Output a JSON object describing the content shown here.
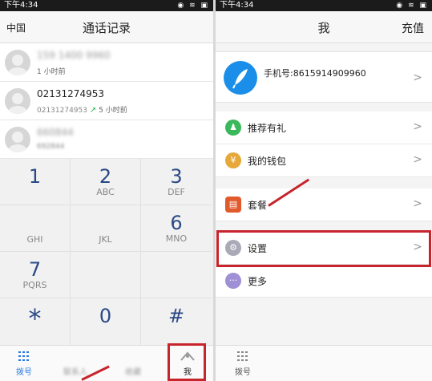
{
  "status_bar": {
    "time": "下午4:34",
    "icons": "◉ ≋ ▣"
  },
  "left": {
    "region_label": "中国",
    "title": "通话记录",
    "calls": [
      {
        "number": "159 1400 9960",
        "time": "1 小时前",
        "blurred": true,
        "sub": ""
      },
      {
        "number": "02131274953",
        "sub": "02131274953",
        "arrow": "↗",
        "time": "5 小时前",
        "blurred": false
      },
      {
        "number": "660844",
        "sub": "692844",
        "time": "",
        "blurred": true
      }
    ],
    "keys": [
      {
        "digit": "1",
        "letters": ""
      },
      {
        "digit": "2",
        "letters": "ABC"
      },
      {
        "digit": "3",
        "letters": "DEF"
      },
      {
        "digit": "",
        "letters": "GHI"
      },
      {
        "digit": "",
        "letters": "JKL"
      },
      {
        "digit": "6",
        "letters": "MNO"
      },
      {
        "digit": "7",
        "letters": "PQRS"
      },
      {
        "digit": "",
        "letters": ""
      },
      {
        "digit": "",
        "letters": ""
      },
      {
        "digit": "*",
        "letters": ""
      },
      {
        "digit": "0",
        "letters": ""
      },
      {
        "digit": "#",
        "letters": ""
      }
    ],
    "tabs": [
      {
        "label": "拨号",
        "icon": "dialpad-icon"
      },
      {
        "label": "联系人",
        "icon": "contacts-icon"
      },
      {
        "label": "收藏",
        "icon": "star-icon"
      },
      {
        "label": "我",
        "icon": "me-icon"
      }
    ]
  },
  "right": {
    "title": "我",
    "action": "充值",
    "phone_label": "手机号:8615914909960",
    "menu": [
      {
        "label": "推荐有礼",
        "icon": "gift-person-icon",
        "color": "#3cb85c"
      },
      {
        "label": "我的钱包",
        "icon": "wallet-icon",
        "color": "#e7a83a"
      },
      {
        "label": "套餐",
        "icon": "package-icon",
        "color": "#e05a2b"
      },
      {
        "label": "设置",
        "icon": "gear-icon",
        "color": "#a9a9b8"
      },
      {
        "label": "更多",
        "icon": "more-icon",
        "color": "#9f8fd4"
      }
    ],
    "tabs": [
      {
        "label": "拨号",
        "icon": "dialpad-icon"
      }
    ]
  },
  "colors": {
    "highlight": "#c7242c",
    "accent": "#2a7ae2",
    "digit": "#2a4a86"
  }
}
